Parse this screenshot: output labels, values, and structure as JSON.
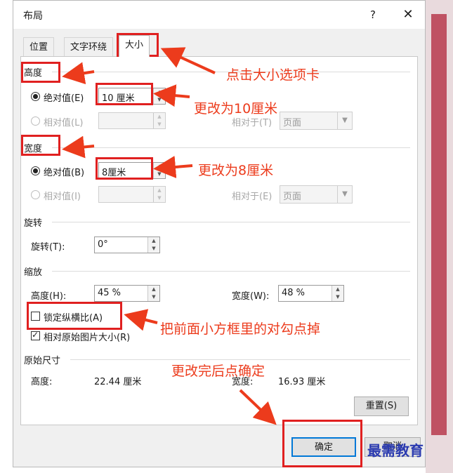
{
  "dialog": {
    "title": "布局",
    "help_label": "?",
    "close_label": "✕"
  },
  "tabs": [
    {
      "label": "位置",
      "active": false
    },
    {
      "label": "文字环绕",
      "active": false
    },
    {
      "label": "大小",
      "active": true
    }
  ],
  "height": {
    "section": "高度",
    "absolute_label": "绝对值(E)",
    "absolute_value": "10 厘米",
    "relative_label": "相对值(L)",
    "relative_to_label": "相对于(T)",
    "relative_to_value": "页面"
  },
  "width": {
    "section": "宽度",
    "absolute_label": "绝对值(B)",
    "absolute_value": "8厘米",
    "relative_label": "相对值(I)",
    "relative_to_label": "相对于(E)",
    "relative_to_value": "页面"
  },
  "rotate": {
    "section": "旋转",
    "label": "旋转(T):",
    "value": "0°"
  },
  "scale": {
    "section": "缩放",
    "height_label": "高度(H):",
    "height_value": "45 %",
    "width_label": "宽度(W):",
    "width_value": "48 %",
    "lock_aspect_label": "锁定纵横比(A)",
    "lock_aspect_checked": false,
    "relative_original_label": "相对原始图片大小(R)",
    "relative_original_checked": true
  },
  "original": {
    "section": "原始尺寸",
    "height_label": "高度:",
    "height_value": "22.44 厘米",
    "width_label": "宽度:",
    "width_value": "16.93 厘米"
  },
  "buttons": {
    "reset": "重置(S)",
    "ok": "确定",
    "cancel": "取消"
  },
  "annotations": {
    "tab_hint": "点击大小选项卡",
    "height_hint": "更改为10厘米",
    "width_hint": "更改为8厘米",
    "lock_hint": "把前面小方框里的对勾点掉",
    "ok_hint": "更改完后点确定",
    "color": "#ec3b1c"
  },
  "watermark": "最需教育"
}
